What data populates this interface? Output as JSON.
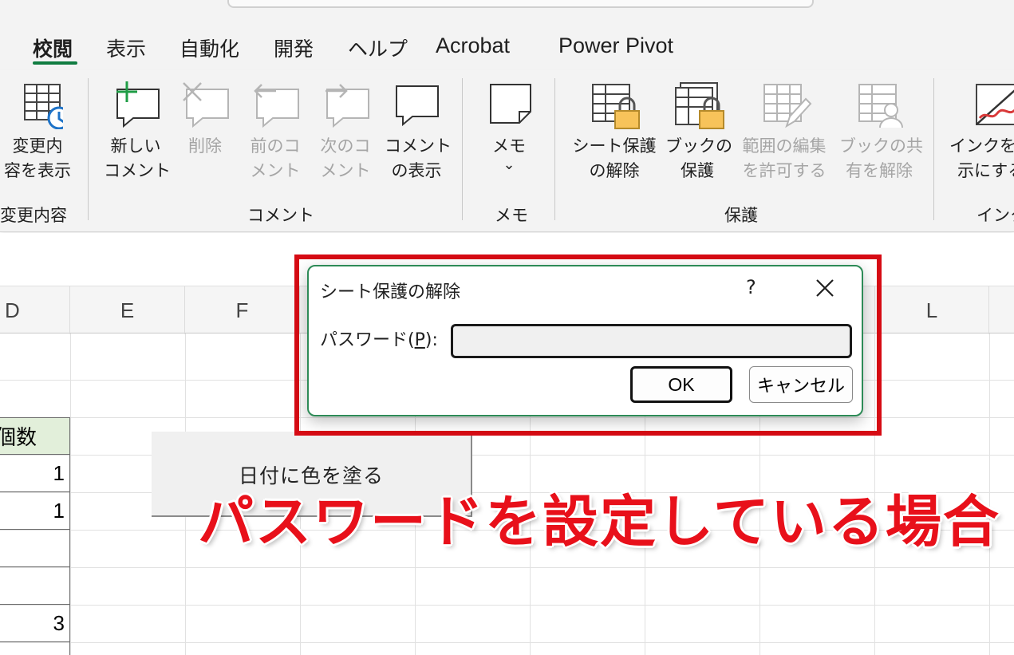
{
  "tabs": [
    "校閲",
    "表示",
    "自動化",
    "開発",
    "ヘルプ",
    "Acrobat",
    "Power Pivot"
  ],
  "ribbon": {
    "show_changes": {
      "line1": "変更内",
      "line2": "容を表示"
    },
    "new_comment": {
      "line1": "新しい",
      "line2": "コメント"
    },
    "delete": {
      "line1": "削除"
    },
    "prev_comment": {
      "line1": "前のコ",
      "line2": "メント"
    },
    "next_comment": {
      "line1": "次のコ",
      "line2": "メント"
    },
    "show_comments": {
      "line1": "コメント",
      "line2": "の表示"
    },
    "memo": {
      "line1": "メモ",
      "caret": "⌄"
    },
    "unprotect_sheet": {
      "line1": "シート保護",
      "line2": "の解除"
    },
    "protect_book": {
      "line1": "ブックの",
      "line2": "保護"
    },
    "allow_edit_ranges": {
      "line1": "範囲の編集",
      "line2": "を許可する"
    },
    "unshare_book": {
      "line1": "ブックの共",
      "line2": "有を解除"
    },
    "hide_ink": {
      "line1": "インクを非",
      "line2": "示にする"
    },
    "groups": {
      "changes": "変更内容",
      "comments": "コメント",
      "memo": "メモ",
      "protect": "保護",
      "ink": "インク"
    }
  },
  "columns": [
    "D",
    "E",
    "F",
    "L"
  ],
  "cells": {
    "header": "個数",
    "d7": "1",
    "d8": "1",
    "d11": "3"
  },
  "shape_button": "日付に色を塗る",
  "annotation": "パスワードを設定している場合",
  "dialog": {
    "title": "シート保護の解除",
    "help": "?",
    "label_prefix": "パスワード(",
    "label_key": "P",
    "label_suffix": "):",
    "password_value": "",
    "ok": "OK",
    "cancel": "キャンセル"
  },
  "colors": {
    "accent_green": "#107c41",
    "highlight_red": "#d60b14",
    "annotation_red": "#e8101a",
    "header_cell_green": "#e2efda"
  },
  "icons": [
    "show-changes-icon",
    "new-comment-icon",
    "delete-comment-icon",
    "previous-comment-icon",
    "next-comment-icon",
    "show-comments-icon",
    "memo-icon",
    "unprotect-sheet-icon",
    "protect-book-icon",
    "allow-edit-ranges-icon",
    "unshare-book-icon",
    "hide-ink-icon",
    "close-icon"
  ]
}
